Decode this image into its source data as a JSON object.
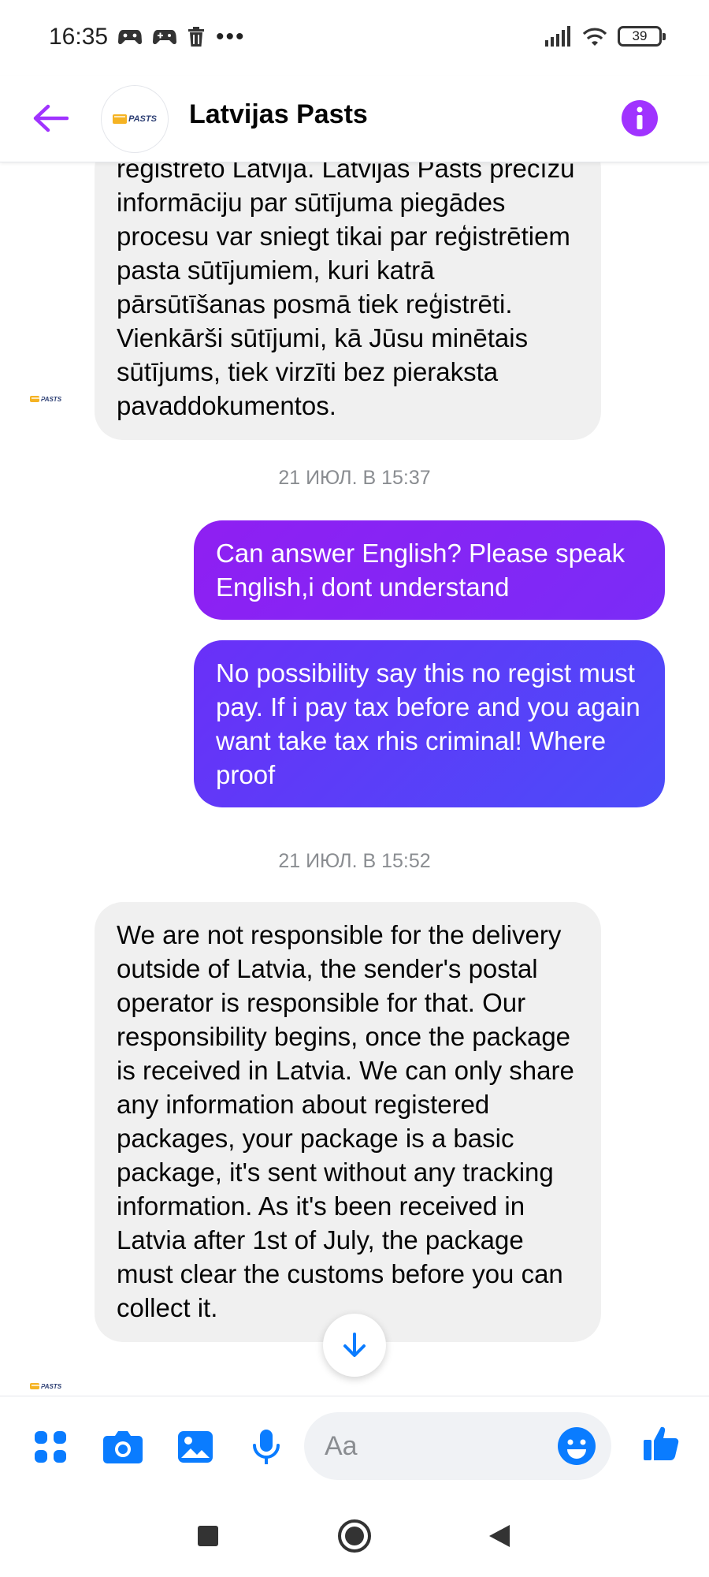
{
  "status_bar": {
    "time": "16:35",
    "more": "•••",
    "battery": "39"
  },
  "header": {
    "title": "Latvijas Pasts",
    "logo_text": "PASTS"
  },
  "messages": [
    {
      "type": "in",
      "text": "reģistrēto Latvijā. Latvijas Pasts precīzu informāciju par sūtījuma piegādes procesu var sniegt tikai par reģistrētiem pasta sūtījumiem, kuri katrā pārsūtīšanas posmā tiek reģistrēti. Vienkārši sūtījumi, kā Jūsu minētais sūtījums, tiek virzīti bez pieraksta pavaddokumentos."
    },
    {
      "type": "timestamp",
      "text": "21 ИЮЛ. В 15:37"
    },
    {
      "type": "out",
      "text": "Can answer English? Please speak English,i dont understand"
    },
    {
      "type": "out",
      "text": "No possibility say this no regist must pay. If i pay tax before and you again want take tax rhis criminal! Where proof"
    },
    {
      "type": "timestamp",
      "text": "21 ИЮЛ. В 15:52"
    },
    {
      "type": "in",
      "text": "We are not responsible for the delivery outside of Latvia, the sender's postal operator is responsible for that. Our responsibility begins, once the package is received in Latvia. We can only share any information about registered packages, your package is a basic package, it's sent without any tracking information. As it's been received in Latvia after 1st of July, the package must clear the customs before you can collect it."
    }
  ],
  "composer": {
    "placeholder": "Aa"
  },
  "colors": {
    "accent": "#a033ff",
    "outgoing_start": "#8f1ff2",
    "outgoing_end": "#4b4cf9",
    "incoming_bg": "#f0f0f0",
    "icon_blue": "#0a7cff"
  }
}
